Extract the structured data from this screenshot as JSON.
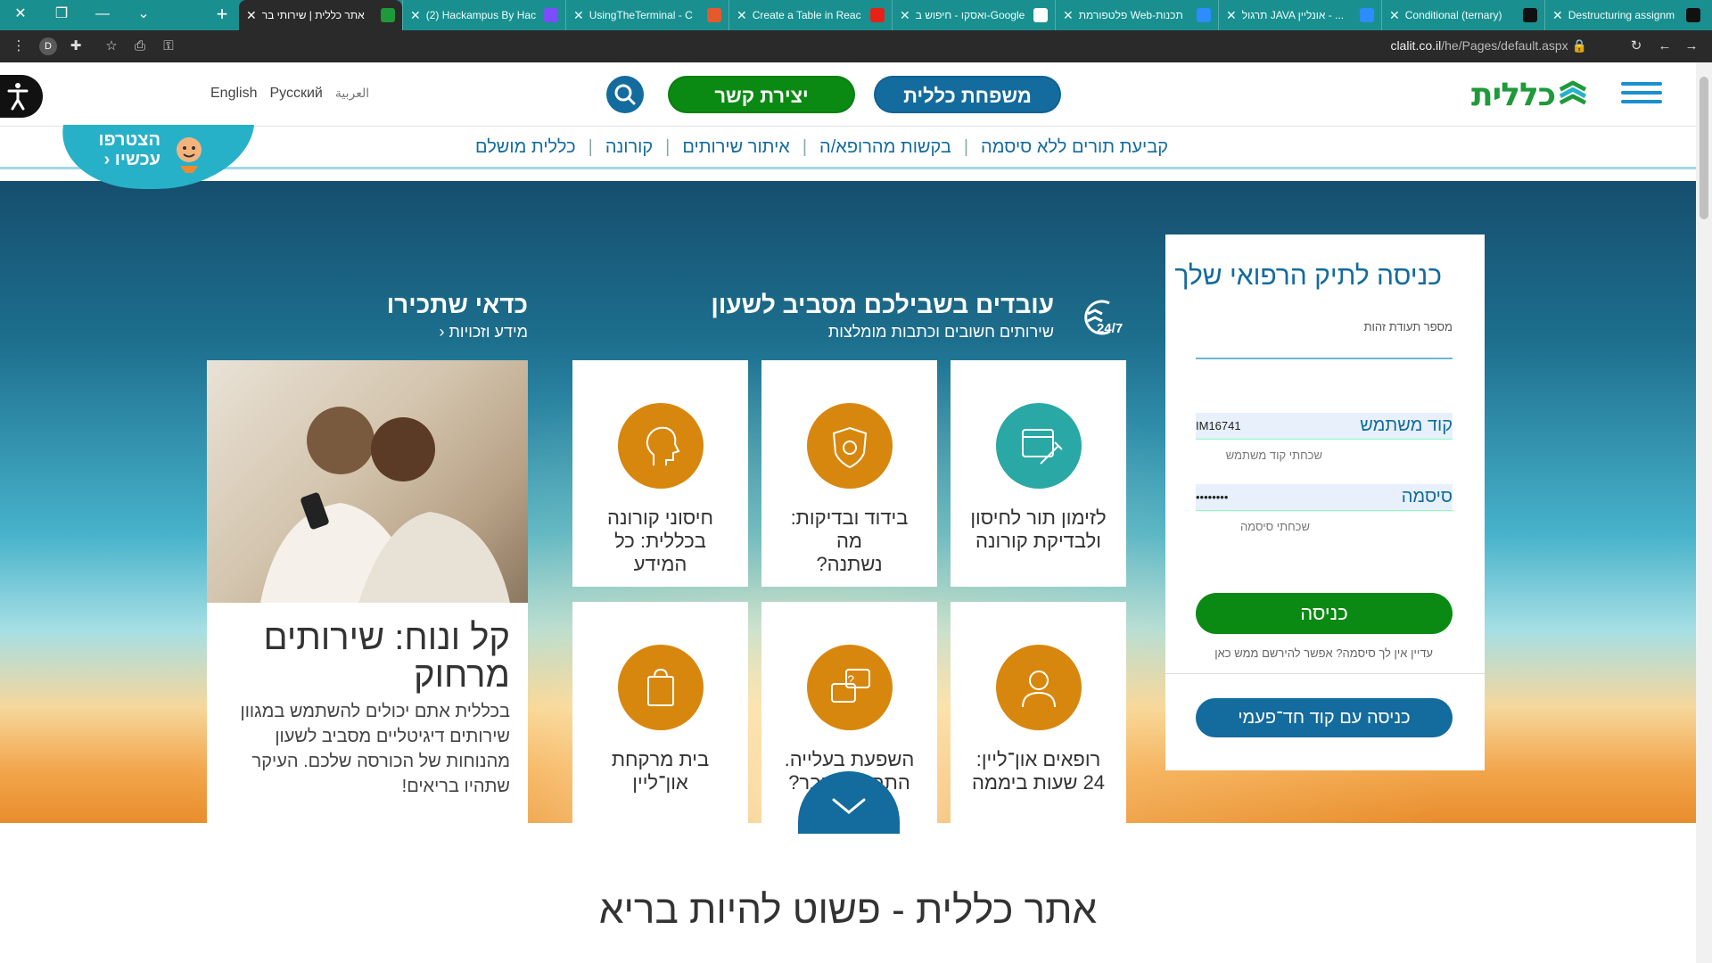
{
  "browser": {
    "tabs": [
      {
        "title": "אתר כללית | שירותי בר",
        "active": true,
        "favicon_color": "#1e9a3a"
      },
      {
        "title": "(2) Hackampus By Hac",
        "active": false,
        "favicon_color": "#7b4dff"
      },
      {
        "title": "UsingTheTerminal - C",
        "active": false,
        "favicon_color": "#e45a2d"
      },
      {
        "title": "Create a Table in Reac",
        "active": false,
        "favicon_color": "#e62117"
      },
      {
        "title": "ואסקו - חיפוש ב-Google",
        "active": false,
        "favicon_color": "#ffffff"
      },
      {
        "title": "פלטפורמת Web-תכנות",
        "active": false,
        "favicon_color": "#2d8cff"
      },
      {
        "title": "תרגול JAVA אונליין - ...",
        "active": false,
        "favicon_color": "#2d8cff"
      },
      {
        "title": "Conditional (ternary)",
        "active": false,
        "favicon_color": "#111111"
      },
      {
        "title": "Destructuring assignm",
        "active": false,
        "favicon_color": "#111111"
      }
    ],
    "url_domain": "clalit.co.il",
    "url_path": "/he/Pages/default.aspx",
    "profile_initial": "D"
  },
  "header": {
    "family_label": "משפחת כללית",
    "contact_label": "יצירת קשר",
    "logo_text": "כללית",
    "languages": [
      "English",
      "Русский",
      "العربية"
    ]
  },
  "nav": {
    "items": [
      "קביעת תורים ללא סיסמה",
      "בקשות מהרופא/ה",
      "איתור שירותים",
      "קורונה",
      "כללית מושלם"
    ],
    "join_label_1": "הצטרפו",
    "join_label_2": "עכשיו"
  },
  "login": {
    "title": "כניסה לתיק הרפואי שלך",
    "id_label": "מספר תעודת זהות",
    "user_label": "קוד משתמש",
    "user_value": "IM16741",
    "forgot_user": "שכחתי קוד משתמש",
    "pass_label": "סיסמה",
    "pass_value": "••••••••",
    "forgot_pass": "שכחתי סיסמה",
    "submit_label": "כניסה",
    "no_password_text": "עדיין אין לך סיסמה? אפשר להירשם ממש כאן",
    "otp_label": "כניסה עם קוד חד־פעמי"
  },
  "services": {
    "title": "עובדים בשבילכם מסביב לשעון",
    "subtitle": "שירותים חשובים וכתבות מומלצות",
    "badge_text": "24/7",
    "cards": [
      {
        "text_1": "לזימון תור לחיסון",
        "text_2": "ולבדיקת קורונה",
        "icon": "calendar-syringe-icon"
      },
      {
        "text_1": "בידוד ובדיקות: מה",
        "text_2": "נשתנה?",
        "icon": "virus-shield-icon"
      },
      {
        "text_1": "חיסוני קורונה",
        "text_2": "בכללית: כל המידע",
        "icon": "head-profile-icon"
      },
      {
        "text_1": "רופאים און־ליין:",
        "text_2": "24 שעות ביממה",
        "icon": "doctor-icon"
      },
      {
        "text_1": "השפעת בעלייה.",
        "text_2": "התחסנת כבר?",
        "icon": "chat-question-icon"
      },
      {
        "text_1": "בית מרקחת",
        "text_2": "און־ליין",
        "icon": "shopping-bag-icon"
      }
    ]
  },
  "featured": {
    "section_title": "כדאי שתכירו",
    "section_link": "מידע וזכויות",
    "card_title": "קל ונוח: שירותים מרחוק",
    "card_text": "בכללית אתם יכולים להשתמש במגוון שירותים דיגיטליים מסביב לשעון מהנוחות של הכורסה שלכם. העיקר שתהיו בריאים!"
  },
  "bottom": {
    "title": "אתר כללית - פשוט להיות בריא"
  },
  "colors": {
    "brand_green": "#1e9a3a",
    "brand_blue": "#136b9e",
    "card_orange": "#d8870e",
    "card_teal": "#2aa8a5",
    "tabbar": "#1a8f8f"
  }
}
